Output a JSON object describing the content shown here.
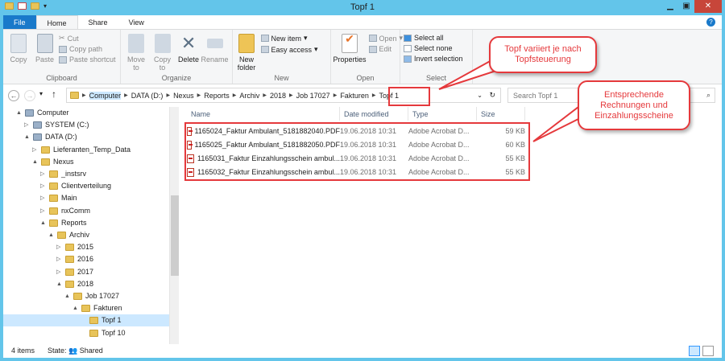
{
  "window": {
    "title": "Topf 1"
  },
  "tabs": [
    "File",
    "Home",
    "Share",
    "View"
  ],
  "ribbon": {
    "clipboard": {
      "label": "Clipboard",
      "copy": "Copy",
      "paste": "Paste",
      "cut": "Cut",
      "copy_path": "Copy path",
      "paste_shortcut": "Paste shortcut"
    },
    "organize": {
      "label": "Organize",
      "move_to": "Move to",
      "copy_to": "Copy to",
      "delete": "Delete",
      "rename": "Rename"
    },
    "new": {
      "label": "New",
      "new_folder": "New folder",
      "new_item": "New item",
      "easy_access": "Easy access"
    },
    "open": {
      "label": "Open",
      "properties": "Properties",
      "open": "Open",
      "edit": "Edit"
    },
    "select": {
      "label": "Select",
      "select_all": "Select all",
      "select_none": "Select none",
      "invert": "Invert selection"
    }
  },
  "address": {
    "crumbs": [
      "Computer",
      "DATA (D:)",
      "Nexus",
      "Reports",
      "Archiv",
      "2018",
      "Job 17027",
      "Fakturen",
      "Topf 1"
    ],
    "search_placeholder": "Search Topf 1"
  },
  "tree": [
    {
      "label": "Computer",
      "level": 0,
      "arrow": "▲"
    },
    {
      "label": "SYSTEM (C:)",
      "level": 1,
      "arrow": "▷"
    },
    {
      "label": "DATA (D:)",
      "level": 1,
      "arrow": "▲"
    },
    {
      "label": "Lieferanten_Temp_Data",
      "level": 2,
      "arrow": "▷"
    },
    {
      "label": "Nexus",
      "level": 2,
      "arrow": "▲"
    },
    {
      "label": "_instsrv",
      "level": 3,
      "arrow": "▷"
    },
    {
      "label": "Clientverteilung",
      "level": 3,
      "arrow": "▷"
    },
    {
      "label": "Main",
      "level": 3,
      "arrow": "▷"
    },
    {
      "label": "nxComm",
      "level": 3,
      "arrow": "▷"
    },
    {
      "label": "Reports",
      "level": 3,
      "arrow": "▲"
    },
    {
      "label": "Archiv",
      "level": 4,
      "arrow": "▲"
    },
    {
      "label": "2015",
      "level": 5,
      "arrow": "▷"
    },
    {
      "label": "2016",
      "level": 5,
      "arrow": "▷"
    },
    {
      "label": "2017",
      "level": 5,
      "arrow": "▷"
    },
    {
      "label": "2018",
      "level": 5,
      "arrow": "▲"
    },
    {
      "label": "Job 17027",
      "level": 6,
      "arrow": "▲"
    },
    {
      "label": "Fakturen",
      "level": 7,
      "arrow": "▲"
    },
    {
      "label": "Topf 1",
      "level": 8,
      "arrow": "",
      "selected": true
    },
    {
      "label": "Topf 10",
      "level": 8,
      "arrow": ""
    }
  ],
  "columns": [
    "Name",
    "Date modified",
    "Type",
    "Size"
  ],
  "files": [
    {
      "name": "1165024_Faktur Ambulant_5181882040.PDF",
      "date": "19.06.2018 10:31",
      "type": "Adobe Acrobat D...",
      "size": "59 KB"
    },
    {
      "name": "1165025_Faktur Ambulant_5181882050.PDF",
      "date": "19.06.2018 10:31",
      "type": "Adobe Acrobat D...",
      "size": "60 KB"
    },
    {
      "name": "1165031_Faktur Einzahlungsschein ambul...",
      "date": "19.06.2018 10:31",
      "type": "Adobe Acrobat D...",
      "size": "55 KB"
    },
    {
      "name": "1165032_Faktur Einzahlungsschein ambul...",
      "date": "19.06.2018 10:31",
      "type": "Adobe Acrobat D...",
      "size": "55 KB"
    }
  ],
  "status": {
    "items": "4 items",
    "state_label": "State:",
    "state": "Shared"
  },
  "annotations": {
    "callout1": "Topf variiert je nach Topfsteuerung",
    "callout2": "Entsprechende Rechnungen und Einzahlungsscheine"
  },
  "colors": {
    "titlebar": "#63c5ea",
    "file_tab": "#1979ca",
    "annotation": "#e5393c"
  }
}
